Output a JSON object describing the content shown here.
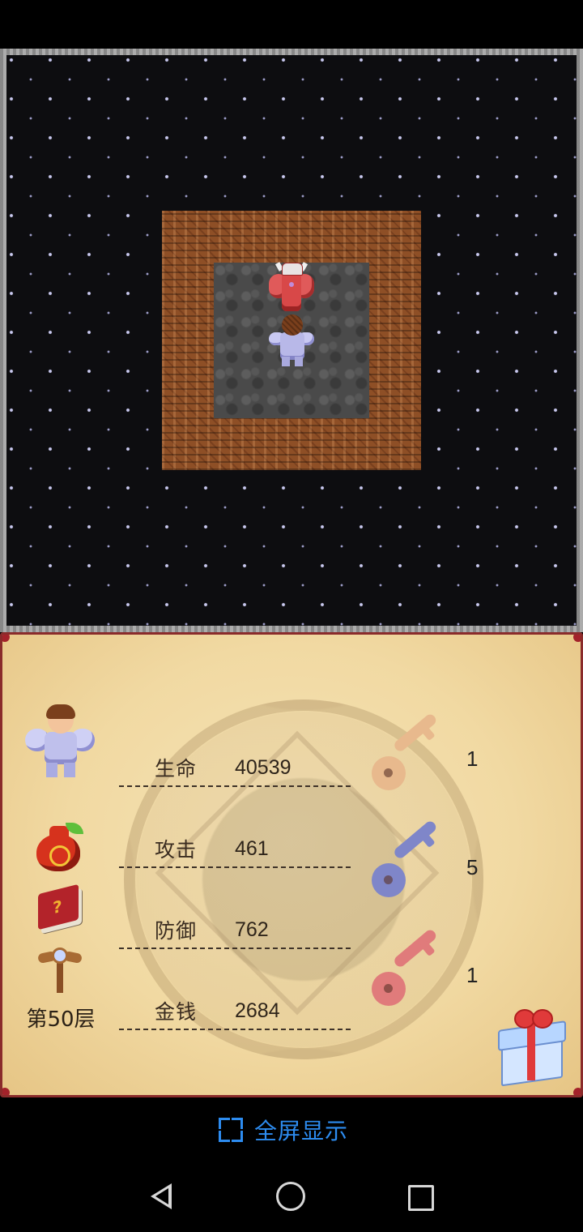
{
  "game": {
    "floor_label": "第50层"
  },
  "stats": [
    {
      "label": "生命",
      "value": "40539"
    },
    {
      "label": "攻击",
      "value": "461"
    },
    {
      "label": "防御",
      "value": "762"
    },
    {
      "label": "金钱",
      "value": "2684"
    }
  ],
  "keys": {
    "yellow": "1",
    "blue": "5",
    "red": "1"
  },
  "colors": {
    "key_yellow": "#e8b98d",
    "key_blue": "#7f86c9",
    "key_red": "#e07b7b",
    "accent_link": "#2d8cf0",
    "panel_border": "#8a2b2b"
  },
  "fullscreen": {
    "label": "全屏显示"
  },
  "icons": {
    "portrait": "hero-portrait-icon",
    "bag": "lucky-bag-icon",
    "book": "monster-book-icon",
    "staff": "floor-fly-staff-icon",
    "gift": "gift-box-icon",
    "fullscreen": "expand-icon"
  }
}
